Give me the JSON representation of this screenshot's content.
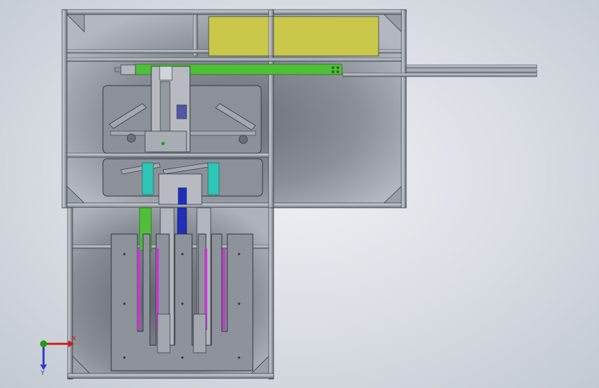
{
  "viewport": {
    "background": "#dde1e7",
    "frame_color": "#4a4f57",
    "panel_color": "#8a8f98",
    "yellow_panel": "#c9c84a",
    "green_rail": "#4fbf3a",
    "blue_part": "#1e2fb8",
    "teal_block": "#2ec6b6",
    "magenta_slot": "#c23bd0"
  },
  "triad": {
    "x_label": "X",
    "y_label": "Y",
    "x_color": "#d11a1a",
    "y_color": "#2a3cc8",
    "z_color": "#18a018"
  }
}
